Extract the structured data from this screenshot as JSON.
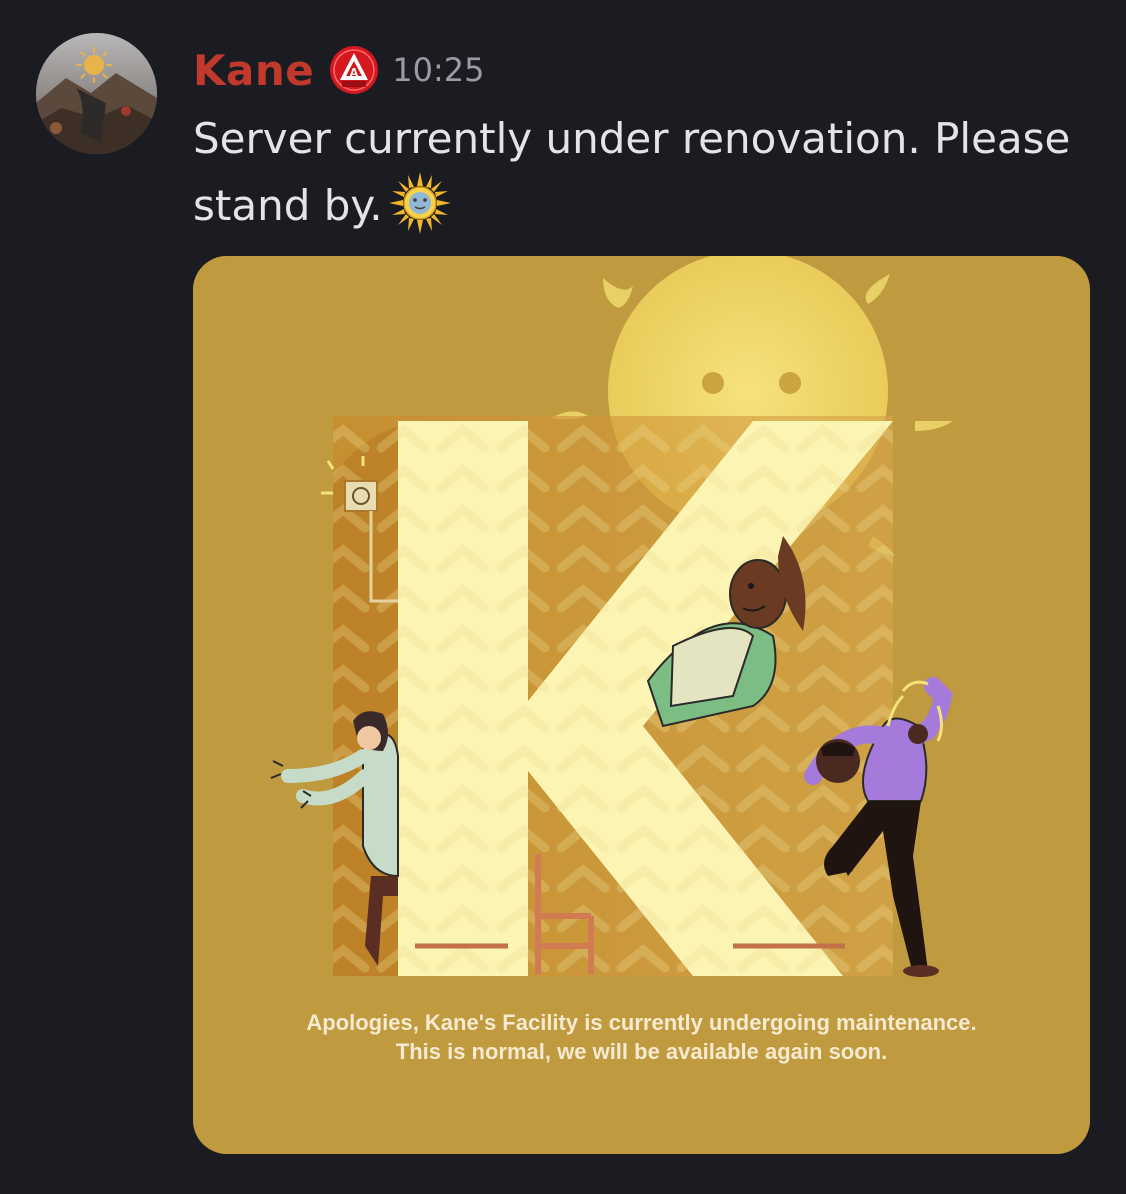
{
  "message": {
    "author": "Kane",
    "timestamp": "10:25",
    "text": "Server currently under renovation. Please stand by.",
    "emoji": "sun-with-face-emoji",
    "role_badge": "A"
  },
  "attachment": {
    "caption_line1": "Apologies, Kane's Facility is currently undergoing maintenance.",
    "caption_line2": "This is normal, we will be available again soon."
  },
  "colors": {
    "background": "#1b1c22",
    "username": "#c0392b",
    "attachment_bg": "#c09a3e",
    "letter_k": "#fbf4b2",
    "sun": "#f2dc6c"
  }
}
